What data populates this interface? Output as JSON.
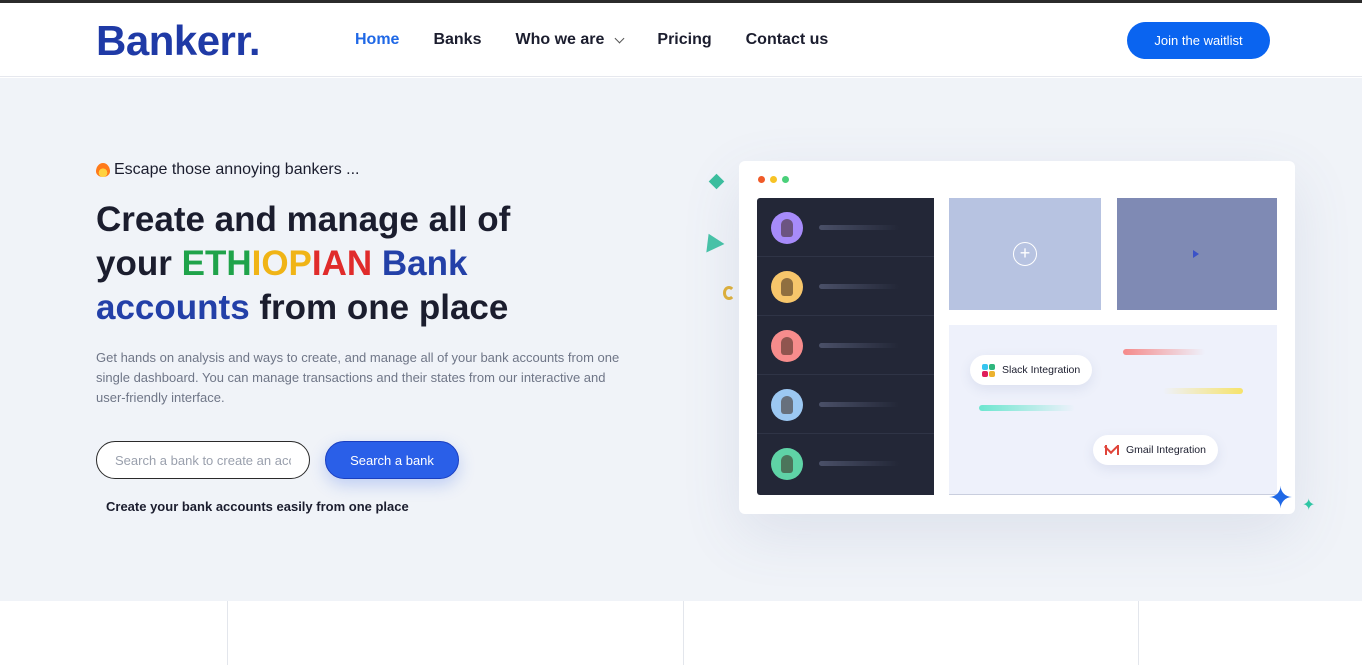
{
  "brand": {
    "logo": "Bankerr.",
    "color": "#1f3aa6",
    "accent": "#0a64f0"
  },
  "nav": {
    "items": [
      {
        "label": "Home",
        "active": true
      },
      {
        "label": "Banks"
      },
      {
        "label": "Who we are",
        "has_dropdown": true
      },
      {
        "label": "Pricing"
      },
      {
        "label": "Contact us"
      }
    ],
    "cta_label": "Join the waitlist"
  },
  "hero": {
    "eyebrow": "Escape those annoying bankers ...",
    "eyebrow_icon": "fire-icon",
    "title": {
      "line1": "Create and manage all of",
      "your": "your",
      "eth": [
        "ETH",
        "IOP",
        "IAN"
      ],
      "bank": "Bank",
      "accounts": "accounts",
      "rest": "from one place"
    },
    "description": "Get hands on analysis and ways to create, and manage all of your bank accounts from one single dashboard. You can manage transactions and their states from our interactive and user-friendly interface.",
    "search": {
      "placeholder": "Search a bank to create an account",
      "button_label": "Search a bank"
    },
    "subtext": "Create your bank accounts easily from one place"
  },
  "illustration": {
    "window_dots": [
      "#f05a28",
      "#f7c325",
      "#4ad07a"
    ],
    "avatars": [
      "#a78bfa",
      "#f7c66b",
      "#f78c8c",
      "#9cc8f2",
      "#5fd3a6"
    ],
    "integrations": [
      {
        "label": "Slack Integration",
        "icon": "slack-icon"
      },
      {
        "label": "Gmail Integration",
        "icon": "gmail-icon"
      }
    ]
  }
}
